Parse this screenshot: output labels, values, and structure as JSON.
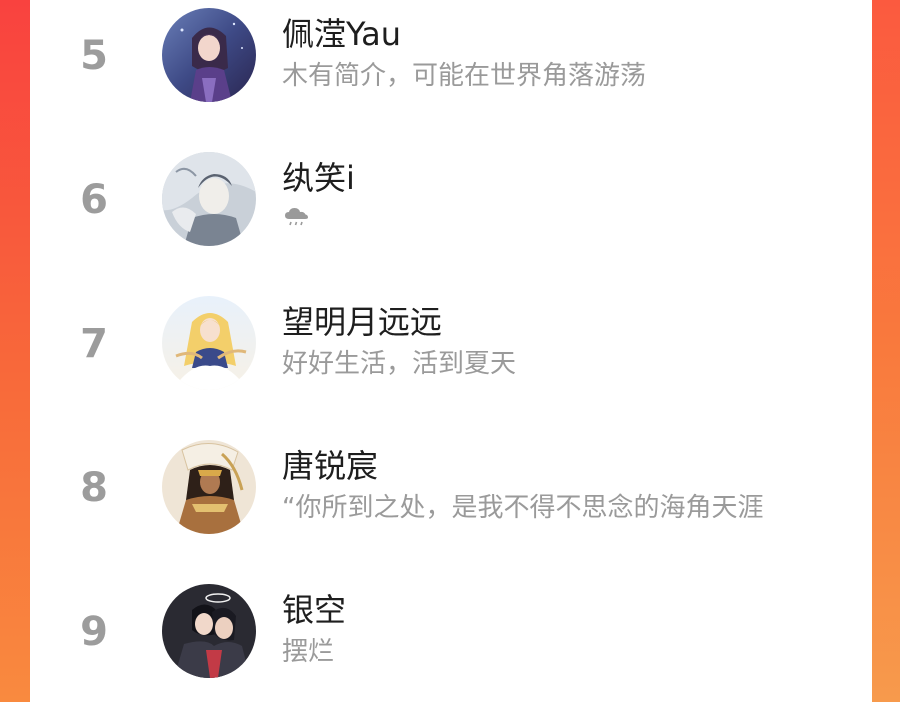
{
  "users": [
    {
      "rank": "5",
      "name": "佩滢Yau",
      "bio": "木有简介，可能在世界角落游荡"
    },
    {
      "rank": "6",
      "name": "纨笑i",
      "bio_icon": "cloud-rain-icon"
    },
    {
      "rank": "7",
      "name": "望明月远远",
      "bio": "好好生活，活到夏天"
    },
    {
      "rank": "8",
      "name": "唐锐宸",
      "bio": "“你所到之处，是我不得不思念的海角天涯"
    },
    {
      "rank": "9",
      "name": "银空",
      "bio": "摆烂"
    }
  ]
}
